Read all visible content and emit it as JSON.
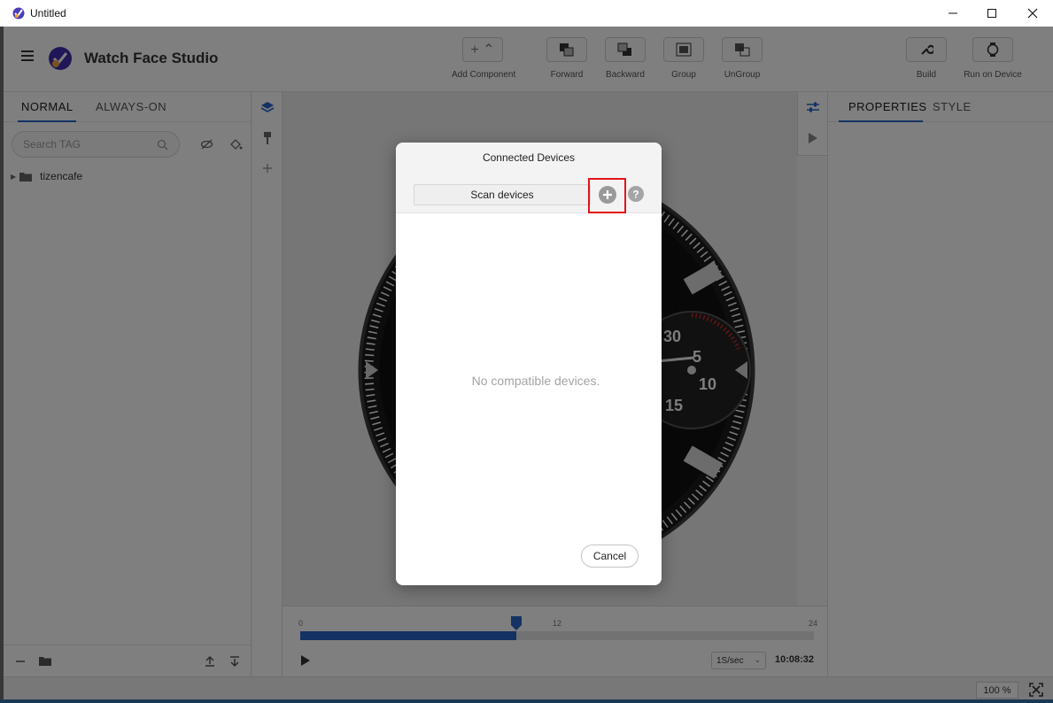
{
  "window": {
    "title": "Untitled"
  },
  "app": {
    "brand": "Watch Face Studio",
    "toolbar": {
      "add_component": "Add Component",
      "forward": "Forward",
      "backward": "Backward",
      "group": "Group",
      "ungroup": "UnGroup",
      "build": "Build",
      "run_on_device": "Run on Device"
    },
    "left_panel": {
      "tabs": [
        "NORMAL",
        "ALWAYS-ON"
      ],
      "active_tab": "NORMAL",
      "search_placeholder": "Search TAG",
      "tree": [
        {
          "label": "tizencafe",
          "type": "folder",
          "expanded": false
        }
      ]
    },
    "right_panel": {
      "tabs": [
        "PROPERTIES",
        "STYLE"
      ],
      "active_tab": "PROPERTIES"
    },
    "timeline": {
      "start": "0",
      "mid": "12",
      "end": "24",
      "progress": 0.42,
      "speed": "1S/sec",
      "time": "10:08:32"
    },
    "status": {
      "zoom": "100 %"
    },
    "watch_labels": [
      "30",
      "5",
      "10",
      "15"
    ]
  },
  "dialog": {
    "title": "Connected Devices",
    "scan_button": "Scan devices",
    "empty_message": "No compatible devices.",
    "cancel_button": "Cancel"
  },
  "colors": {
    "accent": "#2864c8",
    "highlight": "#e3141b",
    "empty_text": "#a3a3a3"
  },
  "icons": [
    "hamburger-icon",
    "app-logo-icon",
    "add-icon",
    "forward-icon",
    "backward-icon",
    "group-icon",
    "ungroup-icon",
    "wrench-icon",
    "watch-icon",
    "search-icon",
    "eye-off-icon",
    "paint-bucket-icon",
    "folder-icon",
    "layers-icon",
    "brush-icon",
    "plus-icon",
    "sliders-icon",
    "play-icon",
    "plus-circle-icon",
    "help-icon",
    "fit-screen-icon"
  ]
}
